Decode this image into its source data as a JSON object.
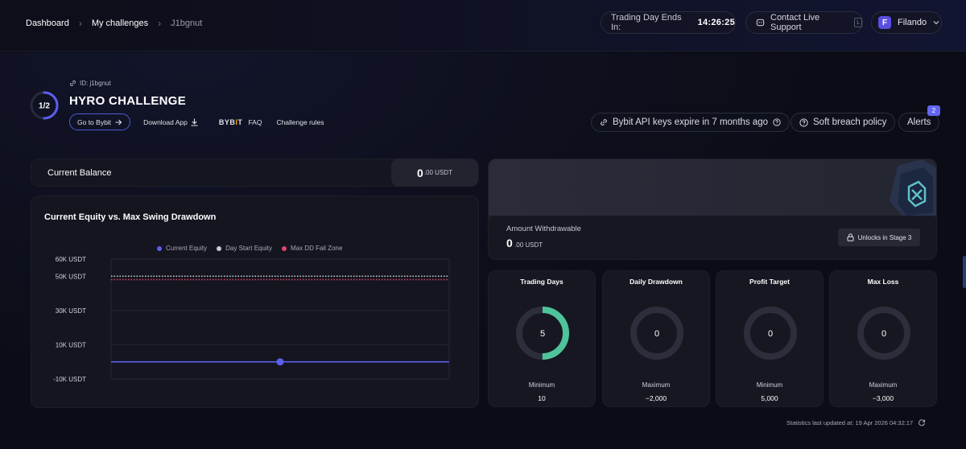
{
  "breadcrumb": {
    "items": [
      "Dashboard",
      "My challenges",
      "J1bgnut"
    ]
  },
  "header": {
    "timer_label": "Trading Day Ends In:",
    "timer_value": "14:26:25",
    "support_label": "Contact Live Support",
    "support_key": "L",
    "user_initial": "F",
    "user_name": "Filando"
  },
  "challenge": {
    "id_label": "ID: j1bgnut",
    "title": "HYRO CHALLENGE",
    "stage": "1/2",
    "stage_progress": 0.5,
    "go_to_label": "Go to Bybit",
    "download_label": "Download App",
    "bybit_logo": "BYBIT",
    "faq_label": "FAQ",
    "rules_label": "Challenge rules",
    "api_keys_label": "Bybit API keys expire in 7 months ago",
    "soft_breach_label": "Soft breach policy",
    "alerts_label": "Alerts",
    "alerts_count": "2"
  },
  "balance": {
    "label": "Current Balance",
    "value": "0",
    "decimals": ".00 USDT"
  },
  "equity_chart": {
    "title": "Current Equity vs. Max Swing Drawdown",
    "legend": [
      "Current Equity",
      "Day Start Equity",
      "Max DD Fail Zone"
    ],
    "colors": {
      "current": "#5b5ff0",
      "day_start": "#c9cad3",
      "fail": "#e0466e"
    }
  },
  "chart_data": {
    "type": "line",
    "title": "Current Equity vs. Max Swing Drawdown",
    "y_ticks": [
      "60K USDT",
      "50K USDT",
      "30K USDT",
      "10K USDT",
      "-10K USDT"
    ],
    "y_tick_values": [
      60000,
      50000,
      30000,
      10000,
      -10000
    ],
    "ylim": [
      -10000,
      60000
    ],
    "series": [
      {
        "name": "Current Equity",
        "value": 0,
        "marker_position": 0.5
      },
      {
        "name": "Day Start Equity",
        "value": 50000
      },
      {
        "name": "Max DD Fail Zone",
        "value": 48000
      }
    ],
    "grid": true,
    "legend_position": "top"
  },
  "withdraw": {
    "label": "Amount Withdrawable",
    "value": "0",
    "decimals": ".00 USDT",
    "unlock_label": "Unlocks in Stage 3"
  },
  "stats": [
    {
      "title": "Trading Days",
      "center": "5",
      "sub_label": "Minimum",
      "sub_value": "10",
      "progress": 0.5,
      "color": "#4fc39a"
    },
    {
      "title": "Daily Drawdown",
      "center": "0",
      "sub_label": "Maximum",
      "sub_value": "−2,000",
      "progress": 0,
      "color": "#4fc39a"
    },
    {
      "title": "Profit Target",
      "center": "0",
      "sub_label": "Minimum",
      "sub_value": "5,000",
      "progress": 0,
      "color": "#4fc39a"
    },
    {
      "title": "Max Loss",
      "center": "0",
      "sub_label": "Maximum",
      "sub_value": "−3,000",
      "progress": 0,
      "color": "#4fc39a"
    }
  ],
  "footer": {
    "updated": "Statistics last updated at: 19 Apr 2026 04:32:17"
  }
}
